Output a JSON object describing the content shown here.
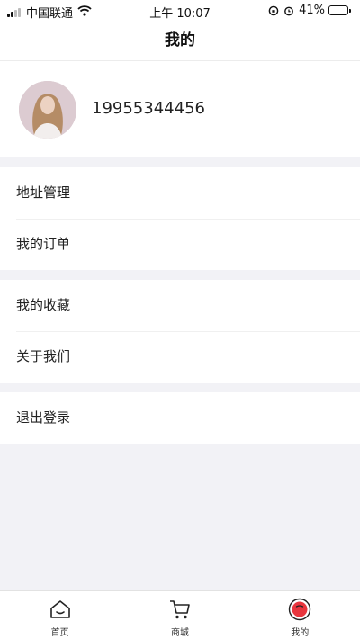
{
  "status_bar": {
    "carrier": "中国联通",
    "time": "上午 10:07",
    "battery_percent": "41%",
    "battery_level": 0.41,
    "icons": [
      "signal-icon",
      "wifi-icon",
      "rotation-lock-icon",
      "alarm-icon",
      "battery-icon"
    ]
  },
  "nav": {
    "title": "我的"
  },
  "profile": {
    "phone": "19955344456"
  },
  "menu": {
    "groups": [
      {
        "items": [
          {
            "label": "地址管理"
          },
          {
            "label": "我的订单"
          }
        ]
      },
      {
        "items": [
          {
            "label": "我的收藏"
          },
          {
            "label": "关于我们"
          }
        ]
      },
      {
        "items": [
          {
            "label": "退出登录"
          }
        ]
      }
    ]
  },
  "tab_bar": {
    "tabs": [
      {
        "label": "首页",
        "icon": "home-icon"
      },
      {
        "label": "商城",
        "icon": "cart-icon"
      },
      {
        "label": "我的",
        "icon": "profile-icon",
        "active": true
      }
    ]
  },
  "colors": {
    "background": "#f2f2f6",
    "accent": "#e8353d",
    "text": "#222222"
  }
}
